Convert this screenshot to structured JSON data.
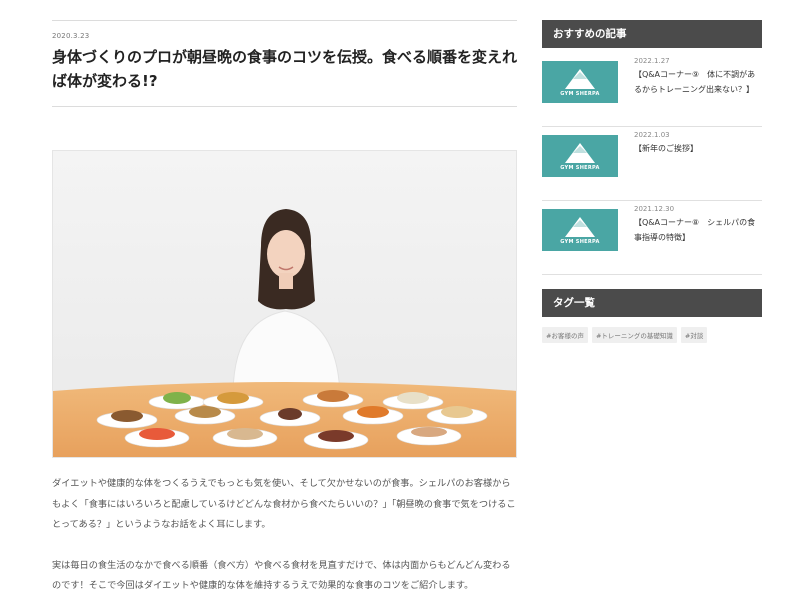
{
  "article": {
    "date": "2020.3.23",
    "title": "身体づくりのプロが朝昼晩の食事のコツを伝授。食べる順番を変えれば体が変わる!?",
    "paragraphs": [
      "ダイエットや健康的な体をつくるうえでもっとも気を使い、そして欠かせないのが食事。シェルパのお客様からもよく「食事にはいろいろと配慮しているけどどんな食材から食べたらいいの？」「朝昼晩の食事で気をつけることってある？」というようなお話をよく耳にします。",
      "実は毎日の食生活のなかで食べる順番（食べ方）や食べる食材を見直すだけで、体は内面からもどんどん変わるのです！そこで今回はダイエットや健康的な体を維持するうえで効果的な食事のコツをご紹介します。"
    ]
  },
  "sidebar": {
    "recommended_heading": "おすすめの記事",
    "thumb_logo": "GYM SHERPA",
    "posts": [
      {
        "date": "2022.1.27",
        "title": "【Q&Aコーナー⑨　体に不調があるからトレーニング出来ない？】"
      },
      {
        "date": "2022.1.03",
        "title": "【新年のご挨拶】"
      },
      {
        "date": "2021.12.30",
        "title": "【Q&Aコーナー⑧　シェルパの食事指導の特徴】"
      }
    ],
    "tags_heading": "タグ一覧",
    "tags": [
      "#お客様の声",
      "#トレーニングの基礎知識",
      "#対談"
    ]
  },
  "colors": {
    "header_bg": "#4b4b4b",
    "thumb_bg": "#4aa6a4",
    "tag_bg": "#efefef"
  }
}
